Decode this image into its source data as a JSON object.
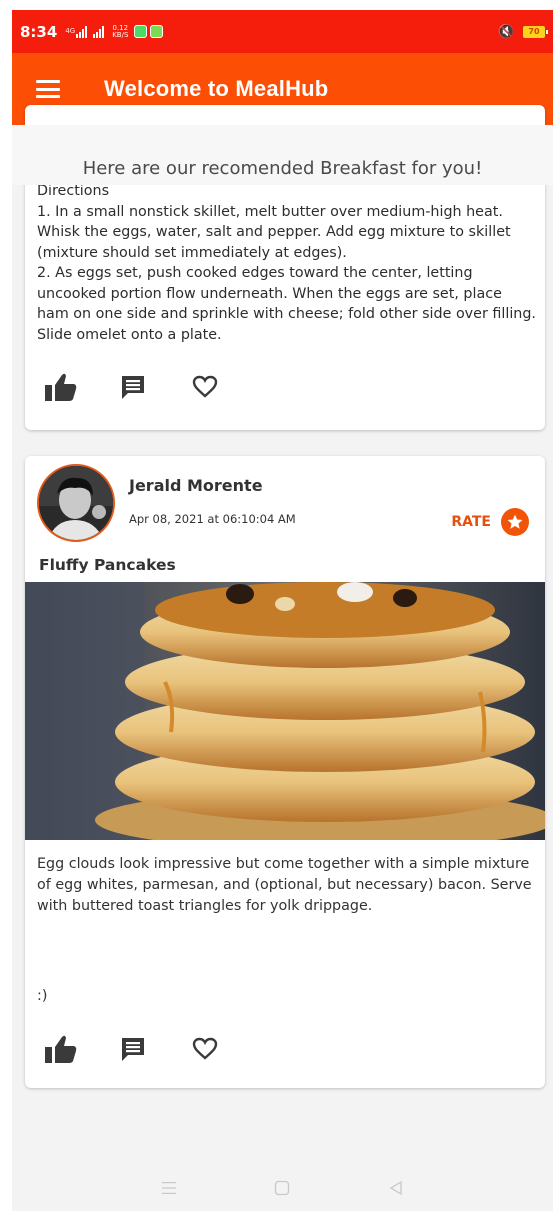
{
  "status_bar": {
    "time": "8:34",
    "network_label": "4G",
    "speed_value": "0.12",
    "speed_unit": "KB/S",
    "battery": "70",
    "icons": [
      "signal-icon",
      "signal-icon",
      "app-notification-icon",
      "app-notification-icon",
      "vibrate-icon",
      "battery-icon"
    ]
  },
  "app_bar": {
    "title": "Welcome to MealHub",
    "menu_icon": "hamburger-menu-icon"
  },
  "subtitle": "Here are our recomended Breakfast for you!",
  "posts": [
    {
      "directions": "Directions\n1. In a small nonstick skillet, melt butter over medium-high heat. Whisk the eggs, water, salt and pepper. Add egg mixture to skillet (mixture should set immediately at edges).\n2. As eggs set, push cooked edges toward the center, letting uncooked portion flow underneath. When the eggs are set, place ham on one side and sprinkle with cheese; fold other side over filling. Slide omelet onto a plate.",
      "actions": [
        "thumbs-up-icon",
        "comment-icon",
        "heart-icon"
      ]
    },
    {
      "author": "Jerald Morente",
      "date": "Apr 08, 2021 at 06:10:04 AM",
      "rate_label": "RATE",
      "title": "Fluffy Pancakes",
      "description": "Egg clouds look impressive but come together with a simple mixture of egg whites, parmesan, and (optional, but necessary) bacon. Serve with buttered toast triangles for yolk drippage.",
      "note": ":)",
      "actions": [
        "thumbs-up-icon",
        "comment-icon",
        "heart-icon"
      ]
    }
  ],
  "nav_bar": [
    "recents-icon",
    "home-icon",
    "back-icon"
  ],
  "colors": {
    "status_bar": "#f51d0b",
    "app_bar": "#fd4e05",
    "accent": "#f25407",
    "action_icon": "#3a3a3a",
    "background": "#f3f3f3"
  }
}
